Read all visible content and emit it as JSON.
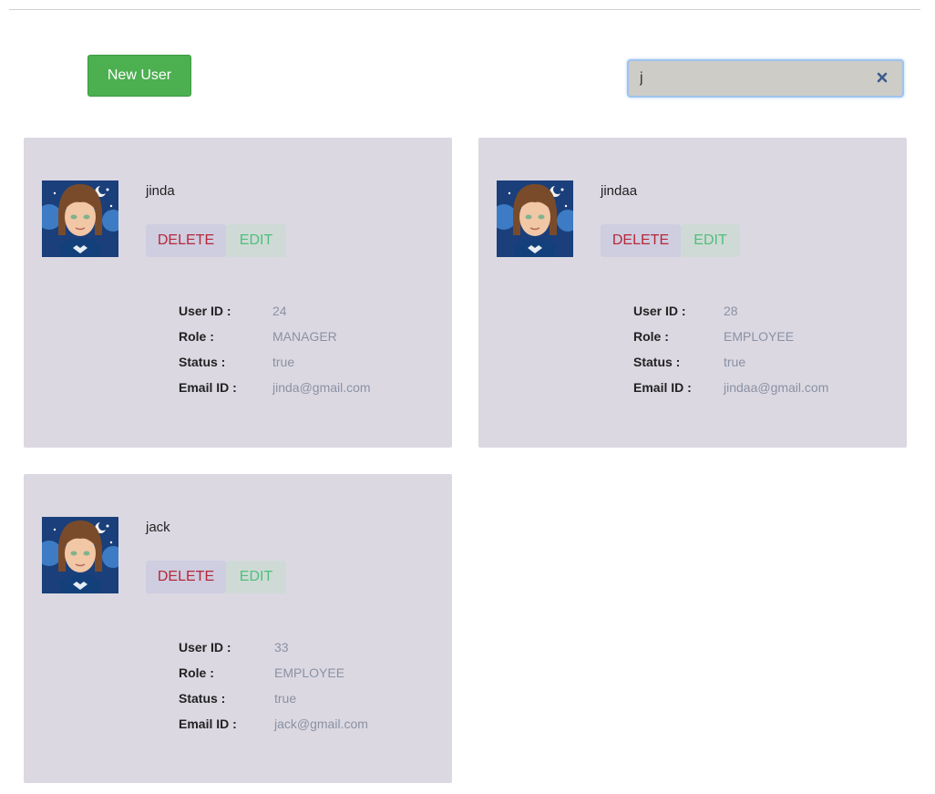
{
  "toolbar": {
    "new_user_label": "New User"
  },
  "search": {
    "value": "j",
    "clear_icon": "close-icon"
  },
  "labels": {
    "user_id": "User ID :",
    "role": "Role :",
    "status": "Status :",
    "email": "Email ID :"
  },
  "actions": {
    "delete": "DELETE",
    "edit": "EDIT"
  },
  "users": [
    {
      "name": "jinda",
      "user_id": "24",
      "role": "MANAGER",
      "status": "true",
      "email": "jinda@gmail.com"
    },
    {
      "name": "jindaa",
      "user_id": "28",
      "role": "EMPLOYEE",
      "status": "true",
      "email": "jindaa@gmail.com"
    },
    {
      "name": "jack",
      "user_id": "33",
      "role": "EMPLOYEE",
      "status": "true",
      "email": "jack@gmail.com"
    }
  ],
  "colors": {
    "primary": "#4caf50",
    "card": "#dbd8e2",
    "delete": "#b5283a",
    "edit": "#4fbf7a"
  }
}
